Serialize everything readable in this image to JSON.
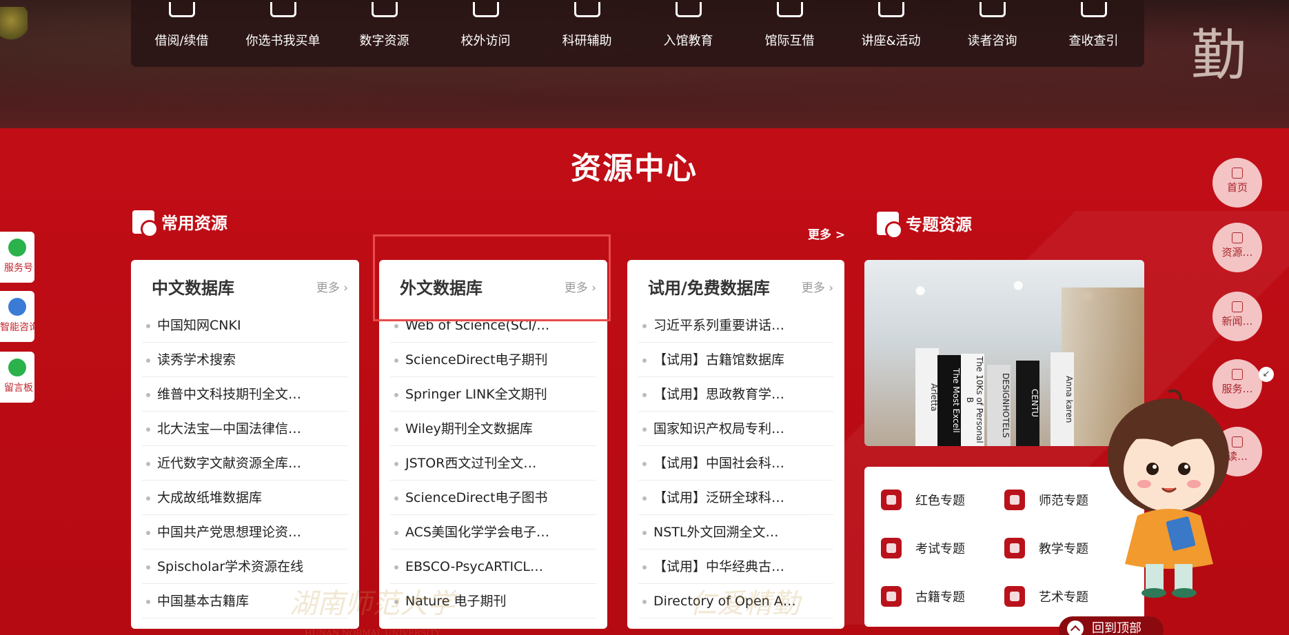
{
  "top_services": [
    {
      "label": "借阅/续借",
      "icon": "book-wallet-icon"
    },
    {
      "label": "你选书我买单",
      "icon": "open-book-icon"
    },
    {
      "label": "数字资源",
      "icon": "layers-icon"
    },
    {
      "label": "校外访问",
      "icon": "monitor-access-icon"
    },
    {
      "label": "科研辅助",
      "icon": "research-icon"
    },
    {
      "label": "入馆教育",
      "icon": "education-icon"
    },
    {
      "label": "馆际互借",
      "icon": "handshake-icon"
    },
    {
      "label": "讲座&活动",
      "icon": "presentation-icon"
    },
    {
      "label": "读者咨询",
      "icon": "consult-icon"
    },
    {
      "label": "查收查引",
      "icon": "search-citation-icon"
    }
  ],
  "banner_calligraphy": "勤",
  "section": {
    "title": "资源中心",
    "common_label": "常用资源",
    "common_more": "更多 >",
    "special_label": "专题资源"
  },
  "cards": [
    {
      "title": "中文数据库",
      "more": "更多 ›",
      "items": [
        "中国知网CNKI",
        "读秀学术搜索",
        "维普中文科技期刊全文…",
        "北大法宝—中国法律信…",
        "近代数字文献资源全库…",
        "大成故纸堆数据库",
        "中国共产党思想理论资…",
        "Spischolar学术资源在线",
        "中国基本古籍库"
      ]
    },
    {
      "title": "外文数据库",
      "more": "更多 ›",
      "items": [
        "Web of Science(SCI/…",
        "ScienceDirect电子期刊",
        "Springer LINK全文期刊",
        "Wiley期刊全文数据库",
        "JSTOR西文过刊全文…",
        "ScienceDirect电子图书",
        "ACS美国化学学会电子…",
        "EBSCO-PsycARTICL…",
        "Nature 电子期刊"
      ]
    },
    {
      "title": "试用/免费数据库",
      "more": "更多 ›",
      "items": [
        "习近平系列重要讲话…",
        "【试用】古籍馆数据库",
        "【试用】思政教育学…",
        "国家知识产权局专利…",
        "【试用】中国社会科…",
        "【试用】泛研全球科…",
        "NSTL外文回溯全文…",
        "【试用】中华经典古…",
        "Directory of Open A…"
      ]
    }
  ],
  "watermarks": {
    "school": "湖南师范大学",
    "school_en": "HUNAN NORMAL UNIVERSITY",
    "motto": "仁爱精勤"
  },
  "book_spines": [
    "Arletta",
    "The Most Excell",
    "The 10Ks of Personal B",
    "DESIGNHOTELS",
    "CENTU",
    "Anna karen"
  ],
  "topics": [
    {
      "label": "红色专题",
      "icon": "hammer-sickle-icon"
    },
    {
      "label": "师范专题",
      "icon": "teacher-icon"
    },
    {
      "label": "考试专题",
      "icon": "exam-icon"
    },
    {
      "label": "教学专题",
      "icon": "teaching-icon"
    },
    {
      "label": "古籍专题",
      "icon": "ancient-book-icon"
    },
    {
      "label": "艺术专题",
      "icon": "art-icon"
    }
  ],
  "left_floats": [
    {
      "label": "服务号",
      "color": "#2bb24c",
      "icon": "wechat-icon"
    },
    {
      "label": "智能咨询",
      "color": "#3a7bd5",
      "icon": "chat-bot-icon"
    },
    {
      "label": "留言板",
      "color": "#2bb24c",
      "icon": "message-board-icon"
    }
  ],
  "right_floats": [
    {
      "label": "首页",
      "icon": "home-icon"
    },
    {
      "label": "资源…",
      "icon": "flower-icon"
    },
    {
      "label": "新闻…",
      "icon": "news-icon"
    },
    {
      "label": "服务…",
      "icon": "grid-icon"
    },
    {
      "label": "读…",
      "icon": "star-icon"
    }
  ],
  "collapse_glyph": "↙",
  "back_to_top": "回到顶部",
  "colors": {
    "brand_red": "#c10d16",
    "highlight": "#e84b4b"
  }
}
